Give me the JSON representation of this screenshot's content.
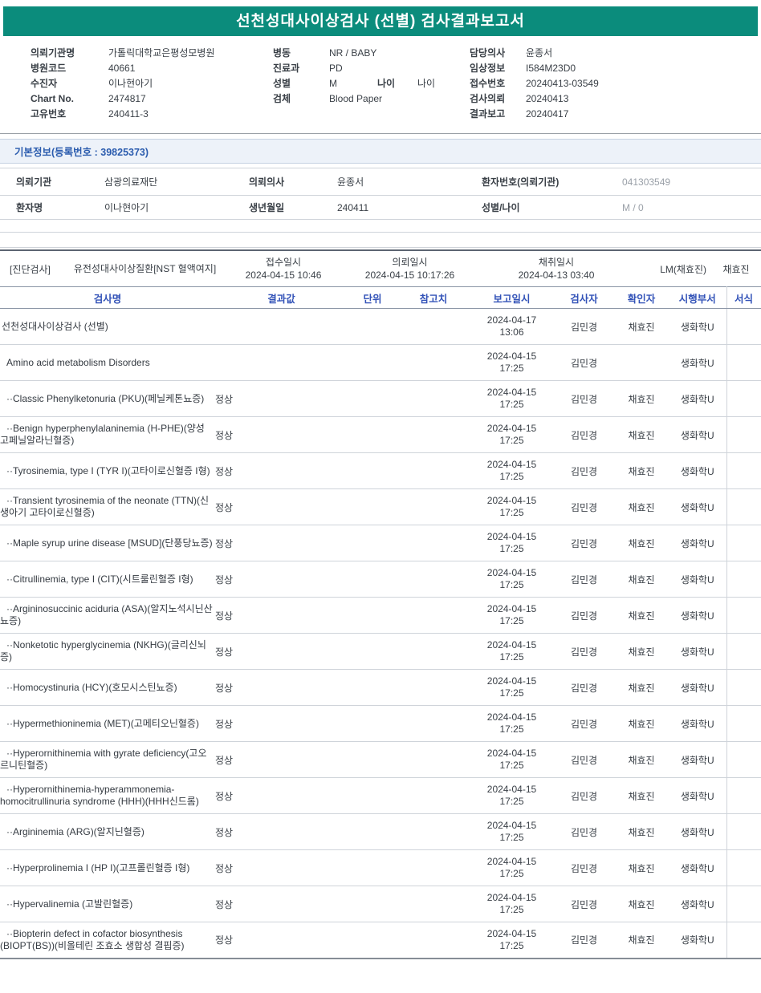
{
  "title": "선천성대사이상검사 (선별) 검사결과보고서",
  "colors": {
    "banner_bg": "#0b8c7c",
    "banner_text": "#ffffff",
    "grid_header_text": "#3353b8",
    "section_heading_text": "#2b5cae",
    "section_heading_bg": "#edf2f9",
    "muted_value_text": "#9aa0a8"
  },
  "patient_header": {
    "left": [
      {
        "label": "의뢰기관명",
        "value": "가톨릭대학교은평성모병원"
      },
      {
        "label": "병원코드",
        "value": "40661"
      },
      {
        "label": "수진자",
        "value": "이나현아기"
      },
      {
        "label": "Chart No.",
        "value": "2474817"
      },
      {
        "label": "고유번호",
        "value": "240411-3"
      }
    ],
    "middle": [
      {
        "label": "병동",
        "value": "NR / BABY"
      },
      {
        "label": "진료과",
        "value": "PD"
      },
      {
        "label": "성별",
        "value": "M",
        "label2": "나이",
        "value2": "나이"
      },
      {
        "label": "검체",
        "value": "Blood Paper"
      }
    ],
    "right": [
      {
        "label": "담당의사",
        "value": "윤종서"
      },
      {
        "label": "임상정보",
        "value": "I584M23D0"
      },
      {
        "label": "접수번호",
        "value": "20240413-03549"
      },
      {
        "label": "검사의뢰",
        "value": "20240413"
      },
      {
        "label": "결과보고",
        "value": "20240417"
      }
    ]
  },
  "basic_info": {
    "heading": "기본정보(등록번호 : 39825373)",
    "row1": {
      "l1": "의뢰기관",
      "v1": "삼광의료재단",
      "l2": "의뢰의사",
      "v2": "윤종서",
      "l3": "환자번호(의뢰기관)",
      "v3": "041303549"
    },
    "row2": {
      "l1": "환자명",
      "v1": "이나현아기",
      "l2": "생년월일",
      "v2": "240411",
      "l3": "성별/나이",
      "v3": "M / 0"
    }
  },
  "diagnosis": {
    "section_label": "[진단검사]",
    "test_group": "유전성대사이상질환[NST 혈액여지]",
    "received": {
      "label": "접수일시",
      "value": "2024-04-15 10:46"
    },
    "requested": {
      "label": "의뢰일시",
      "value": "2024-04-15 10:17:26"
    },
    "collected": {
      "label": "채취일시",
      "value": "2024-04-13 03:40"
    },
    "lm": "LM(채효진)",
    "collector": "채효진"
  },
  "results": {
    "headers": {
      "name": "검사명",
      "result": "결과값",
      "unit": "단위",
      "reference": "참고치",
      "reported": "보고일시",
      "tester": "검사자",
      "confirmer": "확인자",
      "department": "시행부서",
      "form": "서식"
    },
    "rows": [
      {
        "name": "선천성대사이상검사 (선별)",
        "result": "",
        "date": "2024-04-17 13:06",
        "tester": "김민경",
        "confirmer": "채효진",
        "dept": "생화학U"
      },
      {
        "name": "Amino acid metabolism Disorders",
        "result": "",
        "date": "2024-04-15 17:25",
        "tester": "김민경",
        "confirmer": "",
        "dept": "생화학U"
      },
      {
        "name": "··Classic Phenylketonuria (PKU)(페닐케톤뇨증)",
        "result": "정상",
        "date": "2024-04-15 17:25",
        "tester": "김민경",
        "confirmer": "채효진",
        "dept": "생화학U"
      },
      {
        "name": "··Benign hyperphenylalaninemia (H-PHE)(양성 고페닐알라닌혈증)",
        "result": "정상",
        "date": "2024-04-15 17:25",
        "tester": "김민경",
        "confirmer": "채효진",
        "dept": "생화학U"
      },
      {
        "name": "··Tyrosinemia, type I (TYR I)(고타이로신혈증 I형)",
        "result": "정상",
        "date": "2024-04-15 17:25",
        "tester": "김민경",
        "confirmer": "채효진",
        "dept": "생화학U"
      },
      {
        "name": "··Transient tyrosinemia of the neonate (TTN)(신생아기 고타이로신혈증)",
        "result": "정상",
        "date": "2024-04-15 17:25",
        "tester": "김민경",
        "confirmer": "채효진",
        "dept": "생화학U"
      },
      {
        "name": "··Maple syrup urine disease [MSUD](단풍당뇨증)",
        "result": "정상",
        "date": "2024-04-15 17:25",
        "tester": "김민경",
        "confirmer": "채효진",
        "dept": "생화학U"
      },
      {
        "name": "··Citrullinemia, type I (CIT)(시트룰린혈증 I형)",
        "result": "정상",
        "date": "2024-04-15 17:25",
        "tester": "김민경",
        "confirmer": "채효진",
        "dept": "생화학U"
      },
      {
        "name": "··Argininosuccinic aciduria (ASA)(알지노석시닌산뇨증)",
        "result": "정상",
        "date": "2024-04-15 17:25",
        "tester": "김민경",
        "confirmer": "채효진",
        "dept": "생화학U"
      },
      {
        "name": "··Nonketotic hyperglycinemia (NKHG)(글리신뇌증)",
        "result": "정상",
        "date": "2024-04-15 17:25",
        "tester": "김민경",
        "confirmer": "채효진",
        "dept": "생화학U"
      },
      {
        "name": "··Homocystinuria (HCY)(호모시스틴뇨증)",
        "result": "정상",
        "date": "2024-04-15 17:25",
        "tester": "김민경",
        "confirmer": "채효진",
        "dept": "생화학U"
      },
      {
        "name": "··Hypermethioninemia (MET)(고메티오닌혈증)",
        "result": "정상",
        "date": "2024-04-15 17:25",
        "tester": "김민경",
        "confirmer": "채효진",
        "dept": "생화학U"
      },
      {
        "name": "··Hyperornithinemia with gyrate deficiency(고오르니틴혈증)",
        "result": "정상",
        "date": "2024-04-15 17:25",
        "tester": "김민경",
        "confirmer": "채효진",
        "dept": "생화학U"
      },
      {
        "name": "··Hyperornithinemia-hyperammonemia-homocitrullinuria syndrome (HHH)(HHH신드롬)",
        "result": "정상",
        "date": "2024-04-15 17:25",
        "tester": "김민경",
        "confirmer": "채효진",
        "dept": "생화학U"
      },
      {
        "name": "··Argininemia (ARG)(알지닌혈증)",
        "result": "정상",
        "date": "2024-04-15 17:25",
        "tester": "김민경",
        "confirmer": "채효진",
        "dept": "생화학U"
      },
      {
        "name": "··Hyperprolinemia I (HP I)(고프롤린혈증 I형)",
        "result": "정상",
        "date": "2024-04-15 17:25",
        "tester": "김민경",
        "confirmer": "채효진",
        "dept": "생화학U"
      },
      {
        "name": "··Hypervalinemia (고발린혈증)",
        "result": "정상",
        "date": "2024-04-15 17:25",
        "tester": "김민경",
        "confirmer": "채효진",
        "dept": "생화학U"
      },
      {
        "name": "··Biopterin defect in cofactor biosynthesis (BIOPT(BS))(비올테린 조효소 생합성 결핍증)",
        "result": "정상",
        "date": "2024-04-15 17:25",
        "tester": "김민경",
        "confirmer": "채효진",
        "dept": "생화학U"
      }
    ]
  }
}
